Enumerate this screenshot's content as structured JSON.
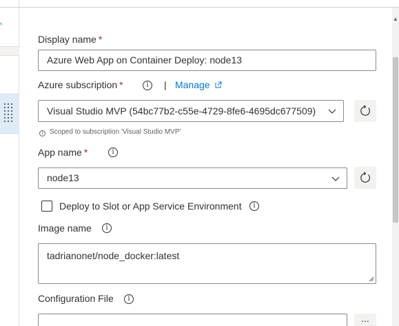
{
  "form": {
    "display_name": {
      "label": "Display name",
      "required": "*",
      "value": "Azure Web App on Container Deploy: node13"
    },
    "azure_subscription": {
      "label": "Azure subscription",
      "required": "*",
      "separator": "|",
      "manage_link": "Manage",
      "value": "Visual Studio MVP (54bc77b2-c55e-4729-8fe6-4695dc677509)",
      "hint": "Scoped to subscription 'Visual Studio MVP'"
    },
    "app_name": {
      "label": "App name",
      "required": "*",
      "value": "node13"
    },
    "deploy_slot": {
      "label": "Deploy to Slot or App Service Environment",
      "checked": false
    },
    "image_name": {
      "label": "Image name",
      "value": "tadrianonet/node_docker:latest"
    },
    "configuration_file": {
      "label": "Configuration File",
      "value": "",
      "browse_label": "..."
    }
  },
  "icons": {
    "info": "info-icon",
    "chevron": "chevron-down-icon",
    "refresh": "refresh-icon",
    "external": "external-link-icon",
    "grip": "drag-handle-icon"
  },
  "colors": {
    "accent": "#0078d4",
    "required": "#a4262c",
    "selected_bg": "#deecf9"
  }
}
